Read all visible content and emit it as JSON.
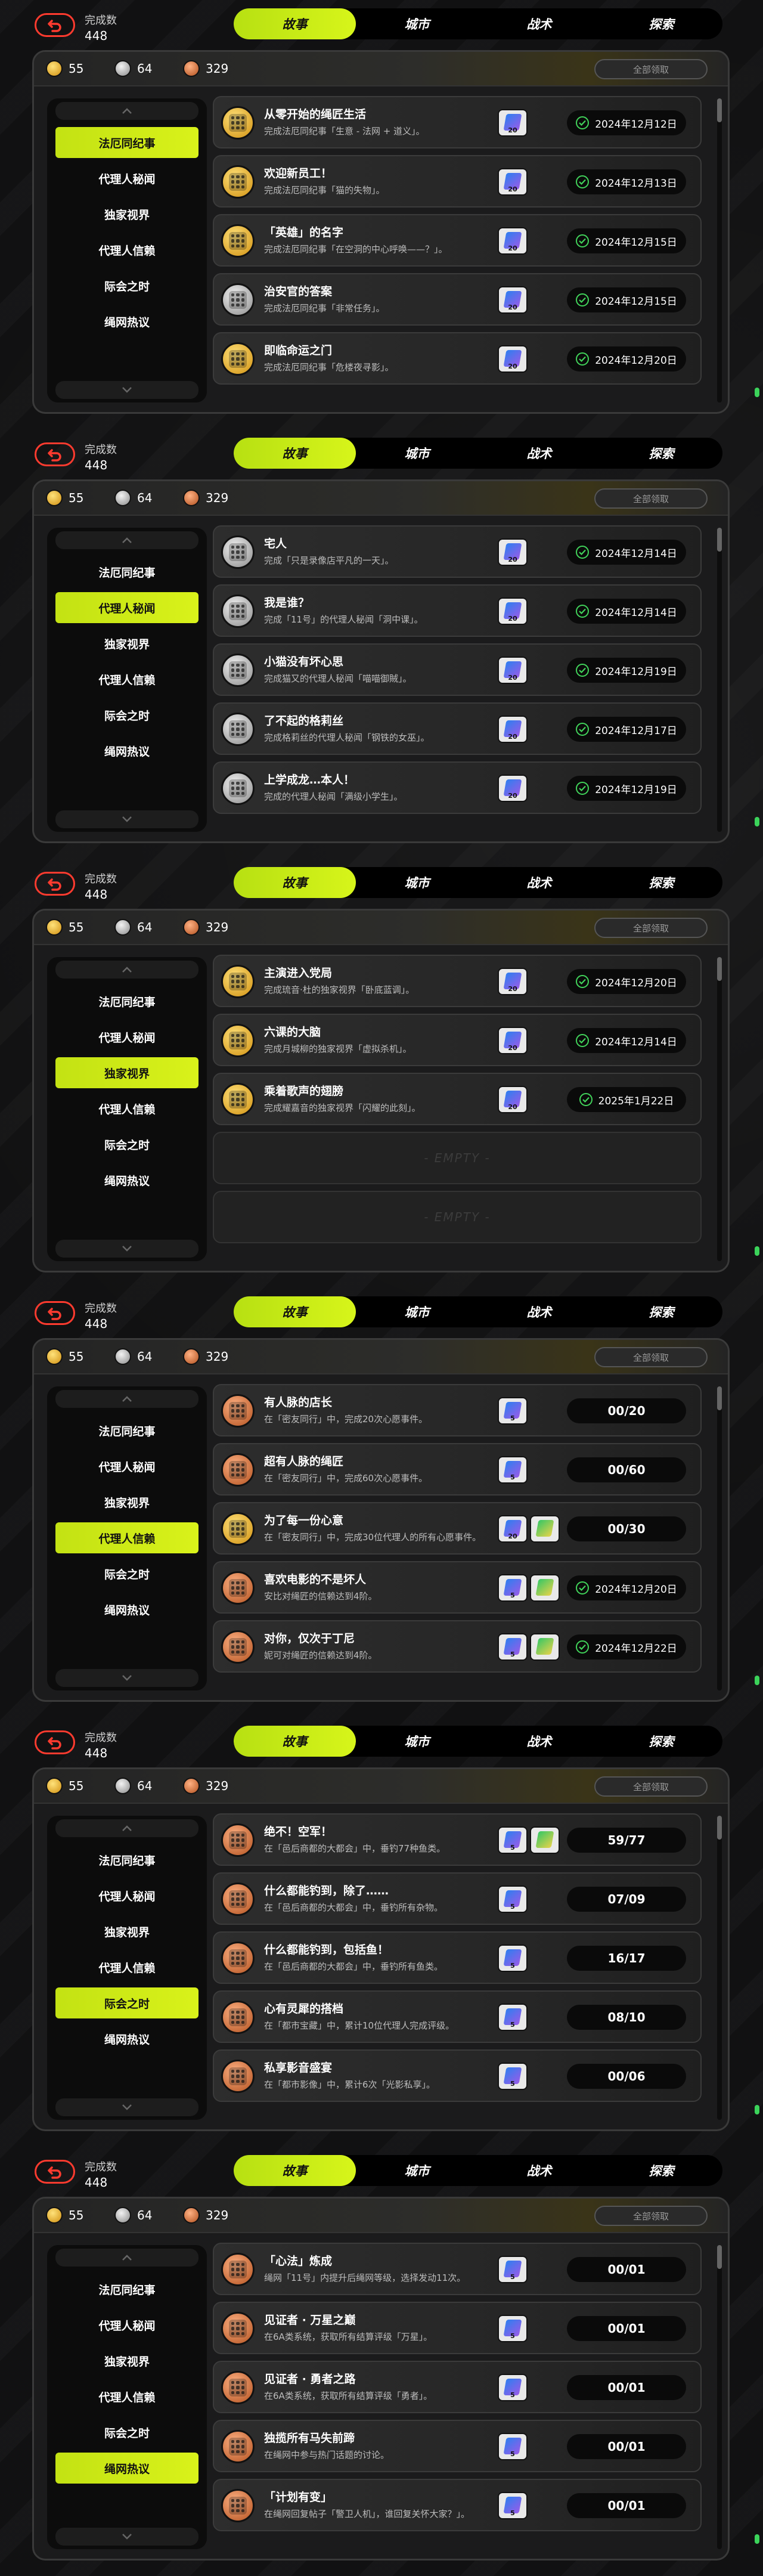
{
  "header": {
    "back_icon": "back-arrow-icon",
    "done_label": "完成数",
    "done_count": "448",
    "tabs": [
      "故事",
      "城市",
      "战术",
      "探索"
    ]
  },
  "currency": {
    "gold": "55",
    "silver": "64",
    "bronze": "329"
  },
  "claim_all_label": "全部领取",
  "categories": [
    "法厄同纪事",
    "代理人秘闻",
    "独家视界",
    "代理人信赖",
    "际会之时",
    "绳网热议"
  ],
  "colors": {
    "accent": "#c8e614",
    "back": "#ff3b2f",
    "check": "#41d35a"
  },
  "panels": [
    {
      "active_category": 0,
      "entries": [
        {
          "medal": "gold",
          "title": "从零开始的绳匠生活",
          "desc": "完成法厄同纪事「生意 - 法网 + 道义」。",
          "rewards": [
            "20"
          ],
          "status_type": "date",
          "status": "2024年12月12日"
        },
        {
          "medal": "gold",
          "title": "欢迎新员工！",
          "desc": "完成法厄同纪事「猫的失物」。",
          "rewards": [
            "20"
          ],
          "status_type": "date",
          "status": "2024年12月13日"
        },
        {
          "medal": "gold",
          "title": "「英雄」的名字",
          "desc": "完成法厄同纪事「在空洞的中心呼唤——？」。",
          "rewards": [
            "20"
          ],
          "status_type": "date",
          "status": "2024年12月15日"
        },
        {
          "medal": "silver",
          "title": "治安官的答案",
          "desc": "完成法厄同纪事「非常任务」。",
          "rewards": [
            "20"
          ],
          "status_type": "date",
          "status": "2024年12月15日"
        },
        {
          "medal": "gold",
          "title": "即临命运之门",
          "desc": "完成法厄同纪事「危楼夜寻影」。",
          "rewards": [
            "20"
          ],
          "status_type": "date",
          "status": "2024年12月20日"
        }
      ],
      "empty_slots": []
    },
    {
      "active_category": 1,
      "entries": [
        {
          "medal": "silver",
          "title": "宅人",
          "desc": "完成「只是录像店平凡的一天」。",
          "rewards": [
            "20"
          ],
          "status_type": "date",
          "status": "2024年12月14日"
        },
        {
          "medal": "silver",
          "title": "我是谁？",
          "desc": "完成「11号」的代理人秘闻「洞中课」。",
          "rewards": [
            "20"
          ],
          "status_type": "date",
          "status": "2024年12月14日"
        },
        {
          "medal": "silver",
          "title": "小猫没有坏心思",
          "desc": "完成猫又的代理人秘闻「喵喵御賊」。",
          "rewards": [
            "20"
          ],
          "status_type": "date",
          "status": "2024年12月19日"
        },
        {
          "medal": "silver",
          "title": "了不起的格莉丝",
          "desc": "完成格莉丝的代理人秘闻「钢铁的女巫」。",
          "rewards": [
            "20"
          ],
          "status_type": "date",
          "status": "2024年12月17日"
        },
        {
          "medal": "silver",
          "title": "上学成龙…本人！",
          "desc": "完成的代理人秘闻「满级小学生」。",
          "rewards": [
            "20"
          ],
          "status_type": "date",
          "status": "2024年12月19日"
        }
      ],
      "empty_slots": []
    },
    {
      "active_category": 2,
      "entries": [
        {
          "medal": "gold",
          "title": "主演进入党局",
          "desc": "完成琉音·杜的独家视界「卧底蓝调」。",
          "rewards": [
            "20"
          ],
          "status_type": "date",
          "status": "2024年12月20日"
        },
        {
          "medal": "gold",
          "title": "六课的大脑",
          "desc": "完成月城柳的独家视界「虚拟杀机」。",
          "rewards": [
            "20"
          ],
          "status_type": "date",
          "status": "2024年12月14日"
        },
        {
          "medal": "gold",
          "title": "乘着歌声的翅膀",
          "desc": "完成耀嘉音的独家视界「闪耀的此刻」。",
          "rewards": [
            "20"
          ],
          "status_type": "date",
          "status": "2025年1月22日"
        }
      ],
      "empty_slots": [
        "- EMPTY -",
        "- EMPTY -"
      ]
    },
    {
      "active_category": 3,
      "entries": [
        {
          "medal": "bronze",
          "title": "有人脉的店长",
          "desc": "在「密友同行」中，完成20次心愿事件。",
          "rewards": [
            "5"
          ],
          "status_type": "progress",
          "status": "00/20"
        },
        {
          "medal": "bronze",
          "title": "超有人脉的绳匠",
          "desc": "在「密友同行」中，完成60次心愿事件。",
          "rewards": [
            "5"
          ],
          "status_type": "progress",
          "status": "00/60"
        },
        {
          "medal": "gold",
          "title": "为了每一份心意",
          "desc": "在「密友同行」中，完成30位代理人的所有心愿事件。",
          "rewards": [
            "20",
            ""
          ],
          "status_type": "progress",
          "status": "00/30"
        },
        {
          "medal": "bronze",
          "title": "喜欢电影的不是坏人",
          "desc": "安比对绳匠的信赖达到4阶。",
          "rewards": [
            "5",
            ""
          ],
          "status_type": "date",
          "status": "2024年12月20日"
        },
        {
          "medal": "bronze",
          "title": "对你，仅次于丁尼",
          "desc": "妮可对绳匠的信赖达到4阶。",
          "rewards": [
            "5",
            ""
          ],
          "status_type": "date",
          "status": "2024年12月22日"
        }
      ],
      "empty_slots": []
    },
    {
      "active_category": 4,
      "entries": [
        {
          "medal": "bronze",
          "title": "绝不！空军！",
          "desc": "在「邑后商都的大都会」中，垂钓77种鱼类。",
          "rewards": [
            "5",
            ""
          ],
          "status_type": "progress",
          "status": "59/77"
        },
        {
          "medal": "bronze",
          "title": "什么都能钓到，除了……",
          "desc": "在「邑后商都的大都会」中，垂钓所有杂物。",
          "rewards": [
            "5"
          ],
          "status_type": "progress",
          "status": "07/09"
        },
        {
          "medal": "bronze",
          "title": "什么都能钓到，包括鱼！",
          "desc": "在「邑后商都的大都会」中，垂钓所有鱼类。",
          "rewards": [
            "5"
          ],
          "status_type": "progress",
          "status": "16/17"
        },
        {
          "medal": "bronze",
          "title": "心有灵犀的搭档",
          "desc": "在「都市宝藏」中，累计10位代理人完成评级。",
          "rewards": [
            "5"
          ],
          "status_type": "progress",
          "status": "08/10"
        },
        {
          "medal": "bronze",
          "title": "私享影音盛宴",
          "desc": "在「都市影像」中，累计6次「光影私享」。",
          "rewards": [
            "5"
          ],
          "status_type": "progress",
          "status": "00/06"
        }
      ],
      "empty_slots": []
    },
    {
      "active_category": 5,
      "entries": [
        {
          "medal": "bronze",
          "title": "「心法」炼成",
          "desc": "绳网「11号」内提升后绳网等级，选择发动11次。",
          "rewards": [
            "5"
          ],
          "status_type": "progress",
          "status": "00/01"
        },
        {
          "medal": "bronze",
          "title": "见证者 · 万星之巅",
          "desc": "在6A类系统，获取所有结算评级「万星」。",
          "rewards": [
            "5"
          ],
          "status_type": "progress",
          "status": "00/01"
        },
        {
          "medal": "bronze",
          "title": "见证者 · 勇者之路",
          "desc": "在6A类系统，获取所有结算评级「勇者」。",
          "rewards": [
            "5"
          ],
          "status_type": "progress",
          "status": "00/01"
        },
        {
          "medal": "bronze",
          "title": "独揽所有马失前蹄",
          "desc": "在绳网中参与热门话题的讨论。",
          "rewards": [
            "5"
          ],
          "status_type": "progress",
          "status": "00/01"
        },
        {
          "medal": "bronze",
          "title": "「计划有变」",
          "desc": "在绳网回复帖子「警卫人机」，谁回复关怀大家？」。",
          "rewards": [
            "5"
          ],
          "status_type": "progress",
          "status": "00/01"
        }
      ],
      "empty_slots": []
    }
  ]
}
